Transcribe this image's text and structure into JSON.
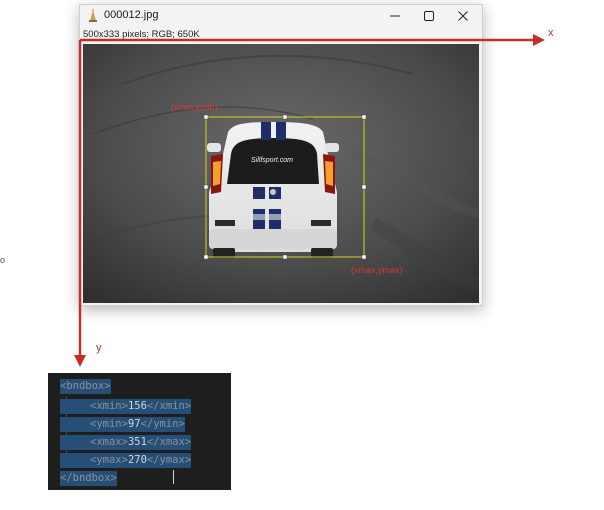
{
  "window": {
    "title": "000012.jpg",
    "info": "500x333 pixels; RGB; 650K",
    "icons": {
      "app": "image-viewer-icon",
      "minimize": "minimize-icon",
      "maximize": "maximize-icon",
      "close": "close-icon"
    }
  },
  "image": {
    "description_text": {
      "top_left": "(xmin,ymin)",
      "bottom_right": "(xmax,ymax)",
      "car_banner": "Sillfsport.com"
    }
  },
  "axes": {
    "x_label": "x",
    "y_label": "y",
    "color": "#c0302b"
  },
  "side_label": "o",
  "xml": {
    "open_tag": "<bndbox>",
    "close_tag": "</bndbox>",
    "lines": [
      {
        "open": "<xmin>",
        "value": "156",
        "close": "</xmin>"
      },
      {
        "open": "<ymin>",
        "value": "97",
        "close": "</ymin>"
      },
      {
        "open": "<xmax>",
        "value": "351",
        "close": "</xmax>"
      },
      {
        "open": "<ymax>",
        "value": "270",
        "close": "</ymax>"
      }
    ]
  }
}
